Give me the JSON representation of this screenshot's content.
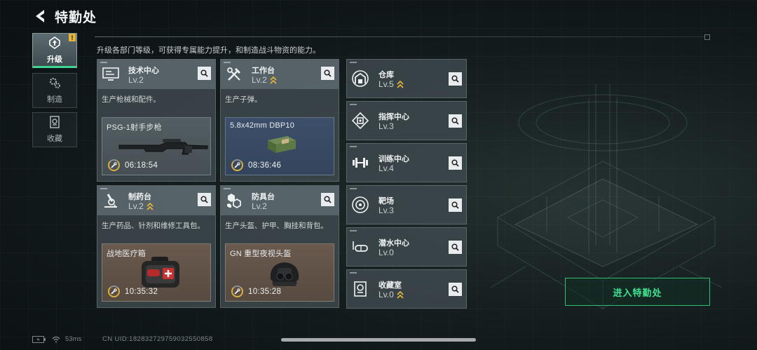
{
  "header": {
    "title": "特勤处"
  },
  "tabs": [
    {
      "label": "升级",
      "icon": "upgrade-icon",
      "active": true,
      "alert": "!"
    },
    {
      "label": "制造",
      "icon": "gear-cluster-icon",
      "active": false
    },
    {
      "label": "收藏",
      "icon": "collection-icon",
      "active": false
    }
  ],
  "subtitle": "升级各部门等级，可获得专属能力提升，和制造战斗物资的能力。",
  "big_cards": [
    {
      "name": "技术中心",
      "level": "Lv.2",
      "upgradable": false,
      "desc": "生产枪械和配件。",
      "product": "PSG-1射手步枪",
      "timer": "06:18:54",
      "theme": "gray",
      "icon": "tech-center-icon"
    },
    {
      "name": "工作台",
      "level": "Lv.2",
      "upgradable": true,
      "desc": "生产子弹。",
      "product": "5.8x42mm DBP10",
      "timer": "08:36:46",
      "theme": "blue",
      "icon": "wrench-hammer-icon"
    },
    {
      "name": "制药台",
      "level": "Lv.2",
      "upgradable": true,
      "desc": "生产药品、针剂和维修工具包。",
      "product": "战地医疗箱",
      "timer": "10:35:32",
      "theme": "brown",
      "icon": "microscope-icon"
    },
    {
      "name": "防具台",
      "level": "Lv.2",
      "upgradable": false,
      "desc": "生产头盔、护甲、胸挂和背包。",
      "product": "GN 重型夜视头盔",
      "timer": "10:35:28",
      "theme": "brown",
      "icon": "armor-parts-icon"
    }
  ],
  "small_cards": [
    {
      "name": "仓库",
      "level": "Lv.5",
      "upgradable": true,
      "icon": "warehouse-icon"
    },
    {
      "name": "指挥中心",
      "level": "Lv.3",
      "upgradable": false,
      "icon": "command-center-icon"
    },
    {
      "name": "训练中心",
      "level": "Lv.4",
      "upgradable": false,
      "icon": "dumbbell-icon"
    },
    {
      "name": "靶场",
      "level": "Lv.3",
      "upgradable": false,
      "icon": "target-icon"
    },
    {
      "name": "潜水中心",
      "level": "Lv.0",
      "upgradable": false,
      "icon": "diving-mask-icon"
    },
    {
      "name": "收藏室",
      "level": "Lv.0",
      "upgradable": true,
      "icon": "collection-room-icon"
    }
  ],
  "enter_button": "进入特勤处",
  "footer": {
    "ping": "53ms",
    "uid": "CN UID:182832729759032550858"
  },
  "colors": {
    "accent_green": "#3fe28f",
    "upgrade_gold": "#e4b53a",
    "timer_gold": "#d9b13c"
  }
}
